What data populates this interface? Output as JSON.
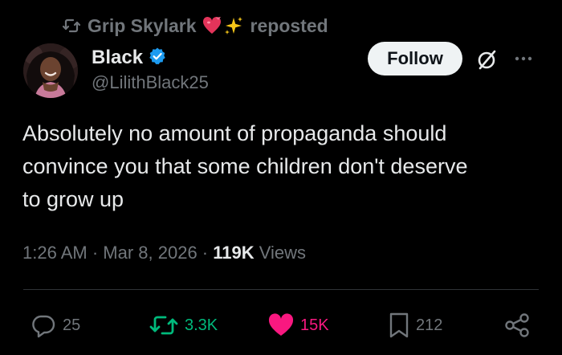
{
  "repost_header": {
    "user": "Grip Skylark",
    "action": "reposted",
    "emojis": [
      "heart-with-ribbon",
      "sparkles"
    ]
  },
  "author": {
    "display_name": "Black",
    "handle": "@LilithBlack25",
    "verified": true,
    "verified_color": "#1d9bf0"
  },
  "follow_button": {
    "label": "Follow"
  },
  "post": {
    "text": "Absolutely no amount of propaganda should\nconvince you that some children don't deserve\nto grow up"
  },
  "meta": {
    "time": "1:26 AM",
    "separator1": " · ",
    "date": "Mar 8, 2026",
    "separator2": " · ",
    "views_count": "119K",
    "views_label": "Views"
  },
  "actions": {
    "replies": "25",
    "reposts": "3.3K",
    "likes": "15K",
    "bookmarks": "212"
  },
  "colors": {
    "background": "#000000",
    "text_primary": "#e7e9ea",
    "text_secondary": "#71767b",
    "repost_green": "#00ba7c",
    "like_pink": "#f91880",
    "divider": "#2f3336"
  },
  "icons": {
    "repost": "repost-icon",
    "reply": "reply-icon",
    "like": "heart-icon",
    "bookmark": "bookmark-icon",
    "share": "share-icon",
    "grok": "grok-icon",
    "more": "more-icon"
  }
}
